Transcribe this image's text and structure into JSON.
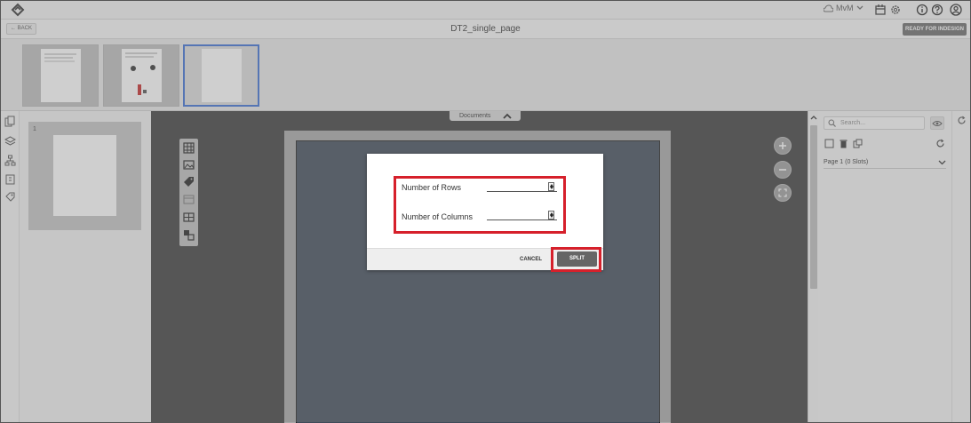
{
  "topbar": {
    "user_initials": "MvM",
    "icons": [
      "app-logo-icon",
      "cloud-icon",
      "chevron-down-icon",
      "calendar-icon",
      "gear-icon",
      "info-icon",
      "help-icon",
      "user-icon"
    ]
  },
  "navbar": {
    "back_label": "← BACK",
    "document_title": "DT2_single_page",
    "ready_button_label": "READY FOR INDESIGN"
  },
  "page_panel": {
    "pages": [
      {
        "number": "1"
      }
    ]
  },
  "canvas": {
    "documents_tab_label": "Documents",
    "tools": [
      "grid-image-icon",
      "image-icon",
      "tag-icon",
      "table-icon",
      "table-grid-icon",
      "swap-icon"
    ],
    "zoom_controls": [
      "zoom-in-icon",
      "zoom-out-icon",
      "fit-screen-icon"
    ]
  },
  "right_panel": {
    "search_placeholder": "Search...",
    "page_row_label": "Page 1 (0 Slots)"
  },
  "modal": {
    "fields": [
      {
        "label": "Number of Rows",
        "value": ""
      },
      {
        "label": "Number of Columns",
        "value": ""
      }
    ],
    "cancel_label": "CANCEL",
    "split_label": "SPLIT"
  },
  "colors": {
    "highlight": "#d6202b",
    "accent_selected_thumb": "#3b6fd4",
    "canvas_bg": "#3d3d3d",
    "page_fill": "#3f4b59"
  }
}
